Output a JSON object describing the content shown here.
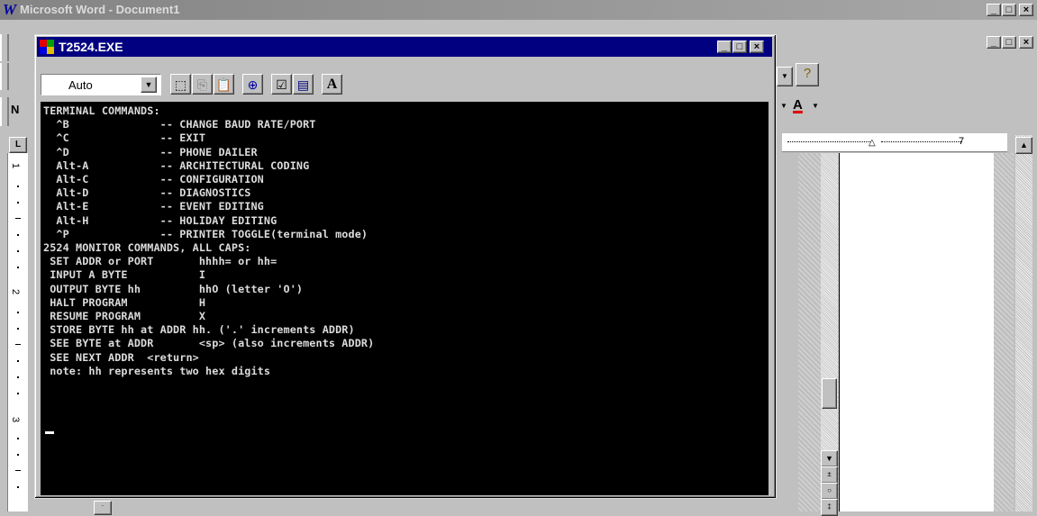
{
  "word": {
    "title": "Microsoft Word - Document1",
    "caption_buttons": [
      "_",
      "□",
      "×"
    ],
    "doc_caption_buttons": [
      "_",
      "□",
      "×"
    ],
    "ruler_mark": "7",
    "font_color_label": "A",
    "left_fragment_labels": [
      "N"
    ],
    "vruler_numbers": [
      "1",
      "2",
      "3"
    ]
  },
  "terminal": {
    "title": "T2524.EXE",
    "caption_buttons": [
      "_",
      "□",
      "×"
    ],
    "font_size_value": "Auto",
    "toolbar_buttons": [
      "select-icon",
      "copy-icon",
      "paste-icon",
      "fullscreen-icon",
      "properties-icon",
      "background-icon",
      "font-icon"
    ],
    "lines": [
      "TERMINAL COMMANDS:",
      "  ^B              -- CHANGE BAUD RATE/PORT",
      "  ^C              -- EXIT",
      "  ^D              -- PHONE DAILER",
      "  Alt-A           -- ARCHITECTURAL CODING",
      "  Alt-C           -- CONFIGURATION",
      "  Alt-D           -- DIAGNOSTICS",
      "  Alt-E           -- EVENT EDITING",
      "  Alt-H           -- HOLIDAY EDITING",
      "  ^P              -- PRINTER TOGGLE(terminal mode)",
      "2524 MONITOR COMMANDS, ALL CAPS:",
      " SET ADDR or PORT       hhhh= or hh=",
      " INPUT A BYTE           I",
      " OUTPUT BYTE hh         hhO (letter 'O')",
      " HALT PROGRAM           H",
      " RESUME PROGRAM         X",
      " STORE BYTE hh at ADDR hh. ('.' increments ADDR)",
      " SEE BYTE at ADDR       <sp> (also increments ADDR)",
      " SEE NEXT ADDR  <return>",
      " note: hh represents two hex digits"
    ]
  }
}
